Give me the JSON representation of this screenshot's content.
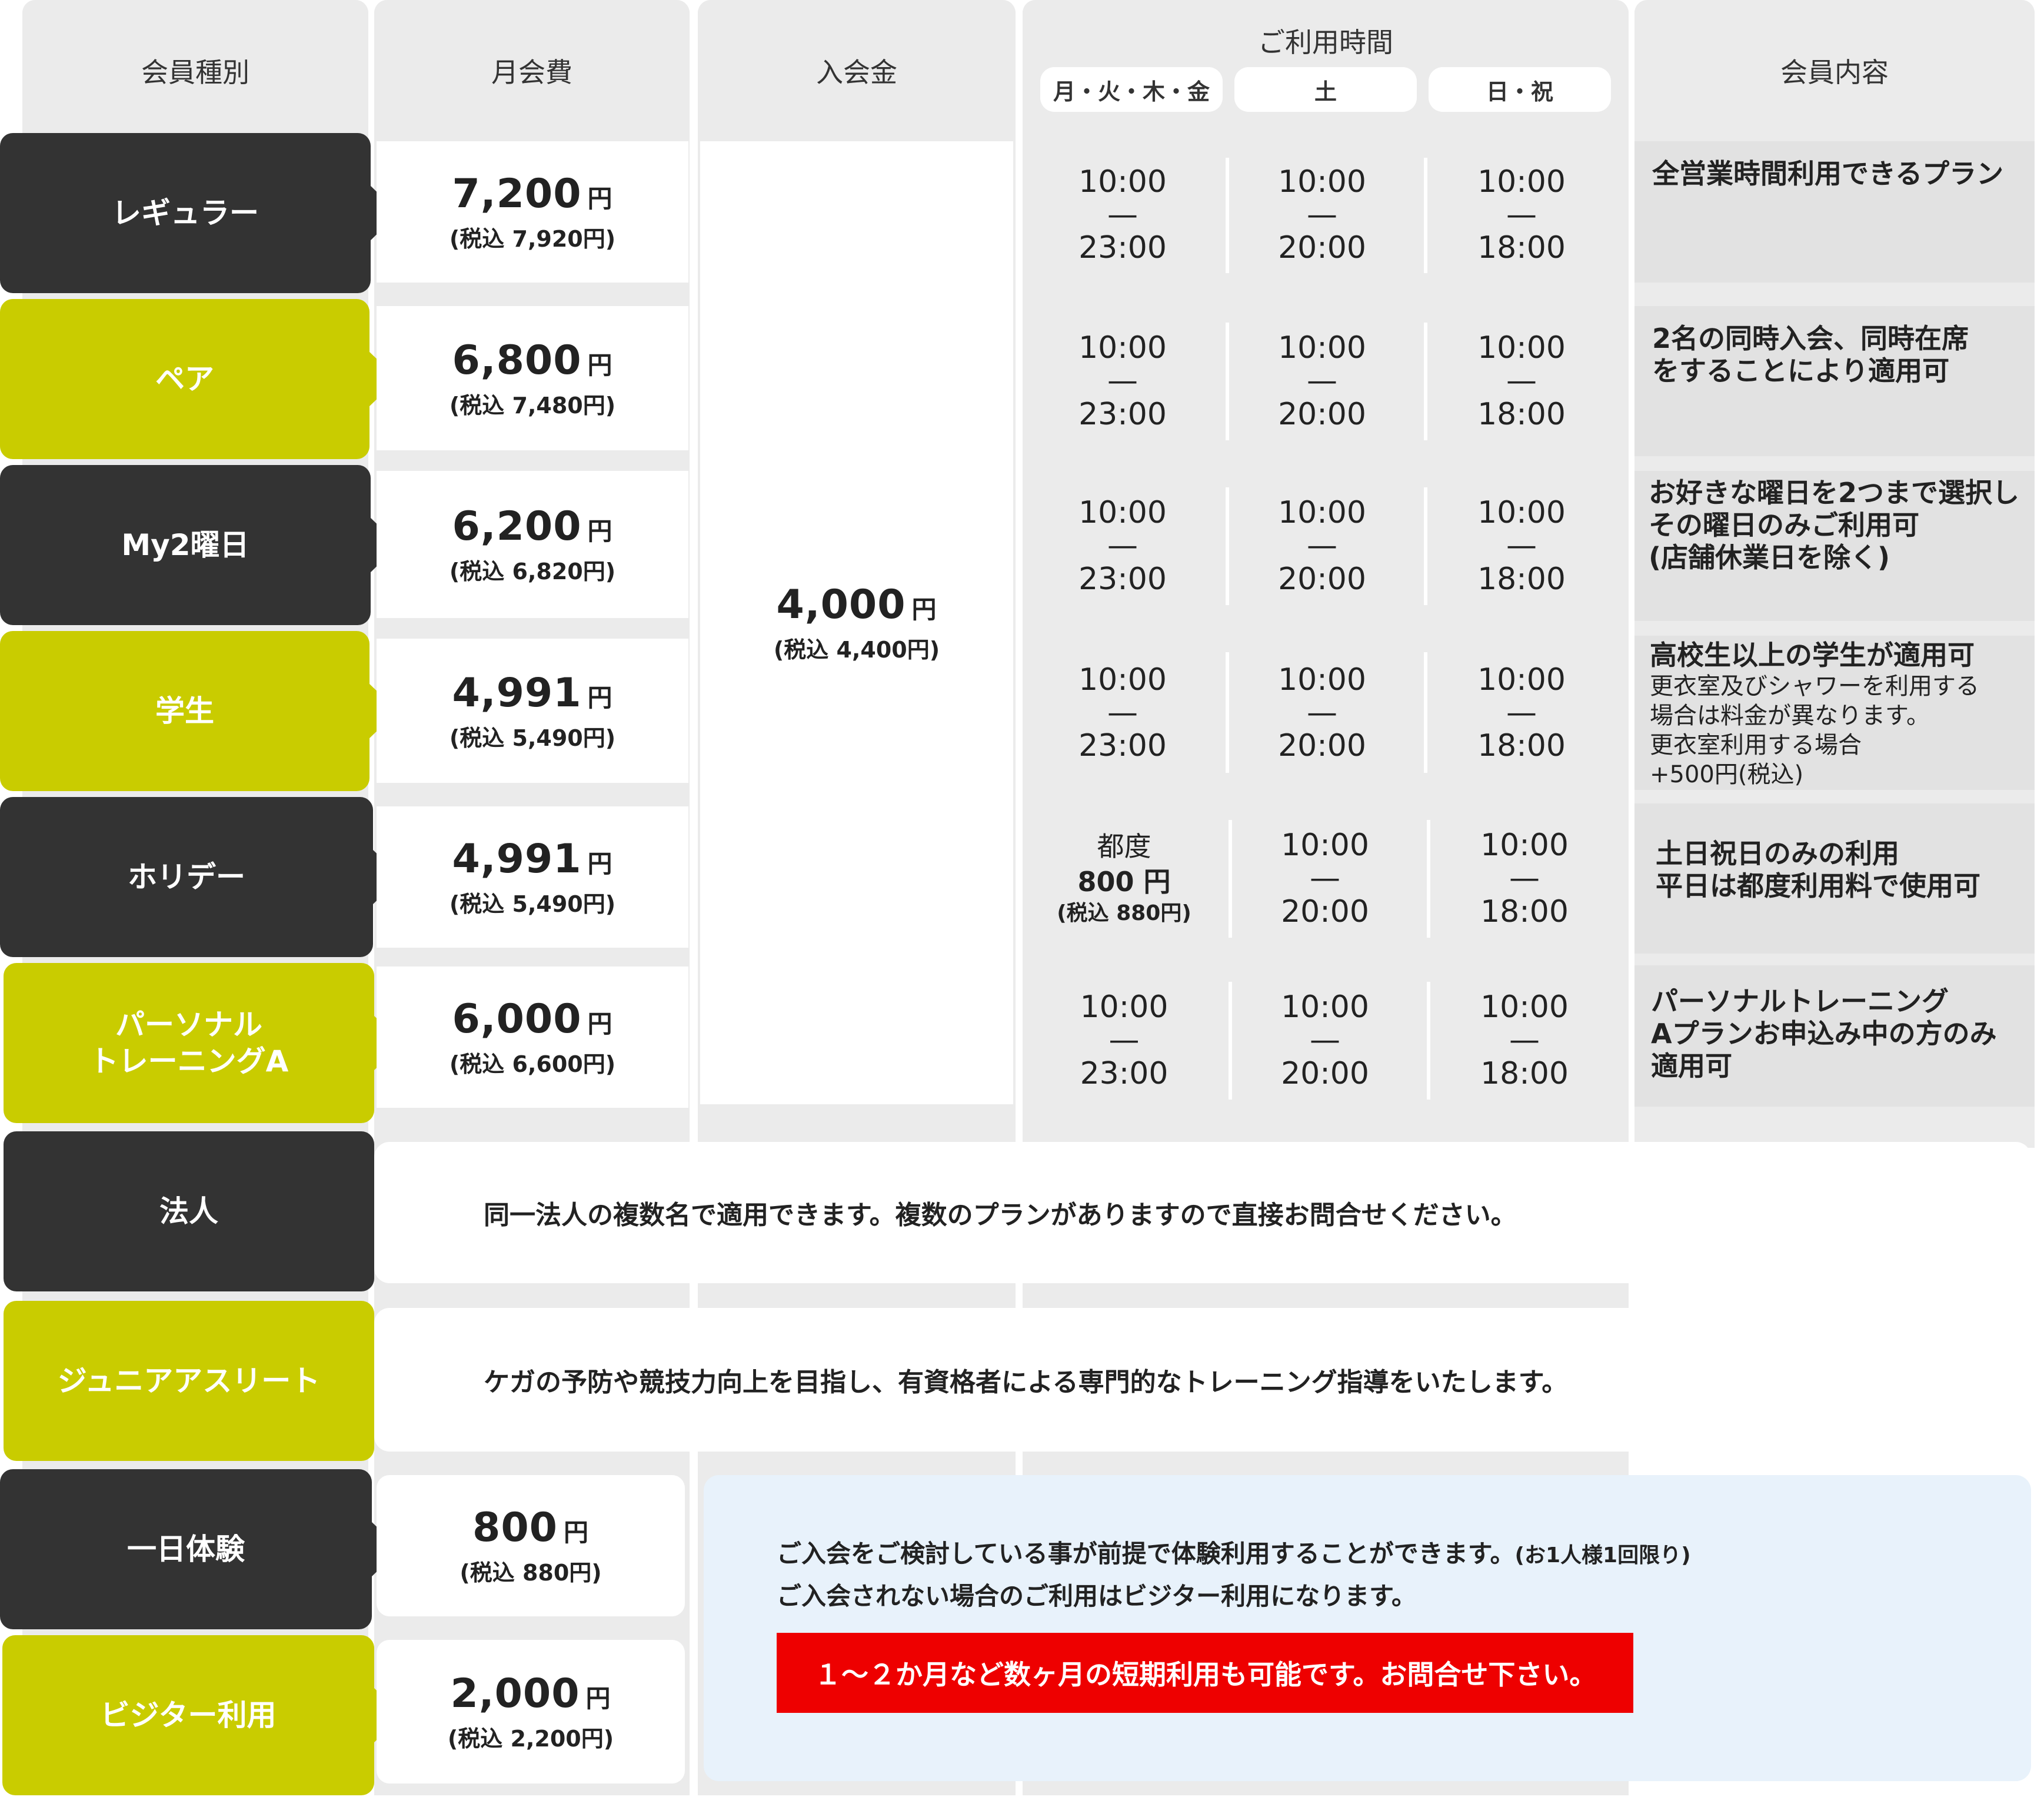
{
  "headers": {
    "member_type": "会員種別",
    "monthly_fee": "月会費",
    "admission_fee": "入会金",
    "usage_time": "ご利用時間",
    "days": [
      "月・火・木・金",
      "土",
      "日・祝"
    ],
    "member_content": "会員内容"
  },
  "admission": {
    "price": "4,000",
    "yen": "円",
    "tax": "(税込 4,400円)"
  },
  "plans": [
    {
      "name": "レギュラー",
      "price": "7,200",
      "yen": "円",
      "tax": "(税込 7,920円)",
      "times": [
        [
          "10:00",
          "—",
          "23:00"
        ],
        [
          "10:00",
          "—",
          "20:00"
        ],
        [
          "10:00",
          "—",
          "18:00"
        ]
      ],
      "desc": [
        "全営業時間利用できるプラン"
      ]
    },
    {
      "name": "ペア",
      "price": "6,800",
      "yen": "円",
      "tax": "(税込 7,480円)",
      "times": [
        [
          "10:00",
          "—",
          "23:00"
        ],
        [
          "10:00",
          "—",
          "20:00"
        ],
        [
          "10:00",
          "—",
          "18:00"
        ]
      ],
      "desc": [
        "2名の同時入会、同時在席",
        "をすることにより適用可"
      ]
    },
    {
      "name": "My2曜日",
      "price": "6,200",
      "yen": "円",
      "tax": "(税込 6,820円)",
      "times": [
        [
          "10:00",
          "—",
          "23:00"
        ],
        [
          "10:00",
          "—",
          "20:00"
        ],
        [
          "10:00",
          "—",
          "18:00"
        ]
      ],
      "desc": [
        "お好きな曜日を2つまで選択し",
        "その曜日のみご利用可",
        "(店舗休業日を除く)"
      ]
    },
    {
      "name": "学生",
      "price": "4,991",
      "yen": "円",
      "tax": "(税込 5,490円)",
      "times": [
        [
          "10:00",
          "—",
          "23:00"
        ],
        [
          "10:00",
          "—",
          "20:00"
        ],
        [
          "10:00",
          "—",
          "18:00"
        ]
      ],
      "desc": [
        "高校生以上の学生が適用可"
      ],
      "desc_small": [
        "更衣室及びシャワーを利用する",
        "場合は料金が異なります。",
        "更衣室利用する場合",
        "+500円(税込)"
      ]
    },
    {
      "name": "ホリデー",
      "price": "4,991",
      "yen": "円",
      "tax": "(税込 5,490円)",
      "times": [
        [
          "都度",
          "800 円",
          "(税込 880円)"
        ],
        [
          "10:00",
          "—",
          "20:00"
        ],
        [
          "10:00",
          "—",
          "18:00"
        ]
      ],
      "desc": [
        "土日祝日のみの利用",
        "平日は都度利用料で使用可"
      ]
    },
    {
      "name_lines": [
        "パーソナル",
        "トレーニングA"
      ],
      "price": "6,000",
      "yen": "円",
      "tax": "(税込 6,600円)",
      "times": [
        [
          "10:00",
          "—",
          "23:00"
        ],
        [
          "10:00",
          "—",
          "20:00"
        ],
        [
          "10:00",
          "—",
          "18:00"
        ]
      ],
      "desc": [
        "パーソナルトレーニング",
        "Aプランお申込み中の方のみ",
        "適用可"
      ]
    }
  ],
  "corporate": {
    "name": "法人",
    "text": "同一法人の複数名で適用できます。複数のプランがありますので直接お問合せください。"
  },
  "junior": {
    "name": "ジュニアアスリート",
    "text": "ケガの予防や競技力向上を目指し、有資格者による専門的なトレーニング指導をいたします。"
  },
  "trial": {
    "name": "一日体験",
    "price": "800",
    "yen": "円",
    "tax": "(税込 880円)"
  },
  "visitor": {
    "name": "ビジター利用",
    "price": "2,000",
    "yen": "円",
    "tax": "(税込 2,200円)"
  },
  "info": {
    "line1": "ご入会をご検討している事が前提で体験利用することができます。",
    "line1_note": "(お1人様1回限り)",
    "line2": "ご入会されない場合のご利用はビジター利用になります。",
    "notice": "１〜２か月など数ヶ月の短期利用も可能です。お問合せ下さい。"
  },
  "colors": {
    "dark": "#333333",
    "lime": "#c9cc00",
    "panel": "#ebebeb",
    "info_bg": "#e8f2fb",
    "notice_red": "#ee0000"
  }
}
